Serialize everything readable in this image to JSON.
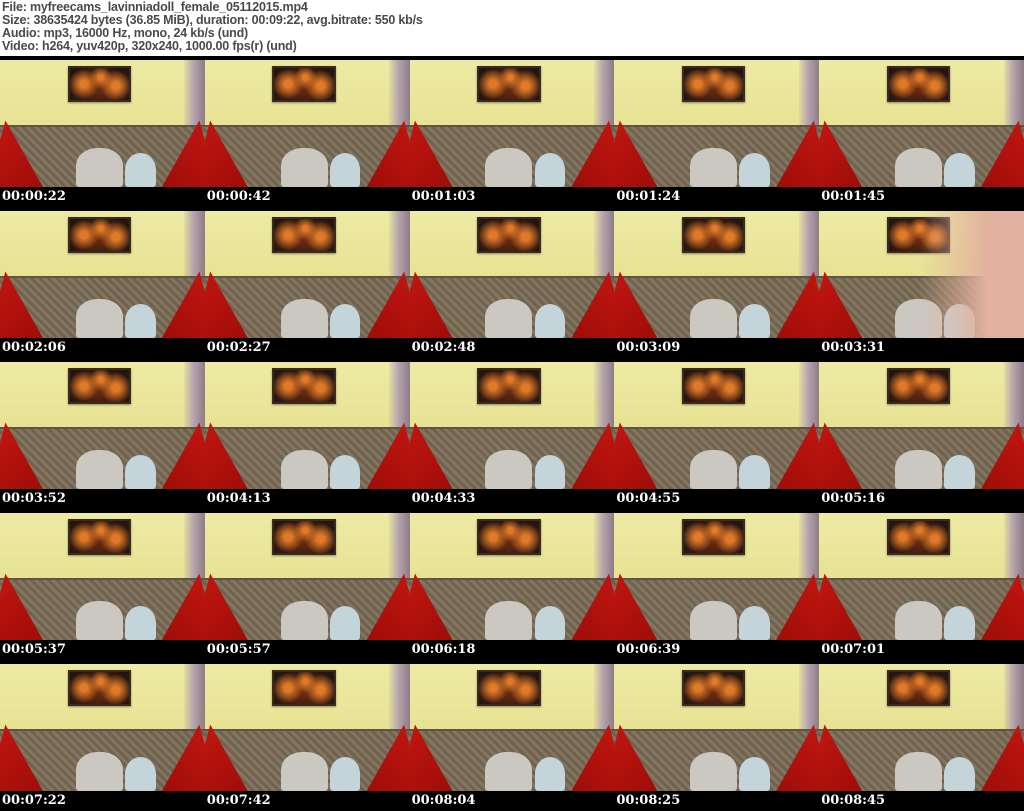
{
  "header": {
    "lines": [
      "File: myfreecams_lavinniadoll_female_05112015.mp4",
      "Size: 38635424 bytes (36.85 MiB), duration: 00:09:22, avg.bitrate: 550 kb/s",
      "Audio: mp3, 16000 Hz, mono, 24 kb/s (und)",
      "Video: h264, yuv420p, 320x240, 1000.00 fps(r) (und)"
    ]
  },
  "grid": {
    "columns": 5,
    "rows": 5,
    "thumbnails": [
      {
        "timestamp": "00:00:22",
        "variant": "room"
      },
      {
        "timestamp": "00:00:42",
        "variant": "room"
      },
      {
        "timestamp": "00:01:03",
        "variant": "room"
      },
      {
        "timestamp": "00:01:24",
        "variant": "room"
      },
      {
        "timestamp": "00:01:45",
        "variant": "room"
      },
      {
        "timestamp": "00:02:06",
        "variant": "room"
      },
      {
        "timestamp": "00:02:27",
        "variant": "room"
      },
      {
        "timestamp": "00:02:48",
        "variant": "room"
      },
      {
        "timestamp": "00:03:09",
        "variant": "room"
      },
      {
        "timestamp": "00:03:31",
        "variant": "closeup"
      },
      {
        "timestamp": "00:03:52",
        "variant": "room"
      },
      {
        "timestamp": "00:04:13",
        "variant": "room"
      },
      {
        "timestamp": "00:04:33",
        "variant": "room"
      },
      {
        "timestamp": "00:04:55",
        "variant": "room"
      },
      {
        "timestamp": "00:05:16",
        "variant": "room"
      },
      {
        "timestamp": "00:05:37",
        "variant": "room"
      },
      {
        "timestamp": "00:05:57",
        "variant": "room"
      },
      {
        "timestamp": "00:06:18",
        "variant": "room"
      },
      {
        "timestamp": "00:06:39",
        "variant": "room"
      },
      {
        "timestamp": "00:07:01",
        "variant": "room"
      },
      {
        "timestamp": "00:07:22",
        "variant": "room"
      },
      {
        "timestamp": "00:07:42",
        "variant": "room"
      },
      {
        "timestamp": "00:08:04",
        "variant": "room"
      },
      {
        "timestamp": "00:08:25",
        "variant": "room"
      },
      {
        "timestamp": "00:08:45",
        "variant": "room"
      }
    ]
  },
  "palette": {
    "header_bg": "#ffffff",
    "header_fg": "#4a4a4a",
    "timestamp_bg": "#000000",
    "timestamp_fg": "#ffffff",
    "letterbox": "#000000",
    "wall": "#e7e292",
    "wall_light": "#edeaa4",
    "couch": "#83755f",
    "couch_dark": "#6f6350",
    "couch_edge": "#5e5444",
    "pillow_red": "#c71712",
    "pillow_red_dark": "#9e0d08",
    "pillow_gray": "#cbc8c2",
    "pillow_blue": "#c3d4da",
    "painting_bg": "#241510",
    "flame": "#e07a28",
    "curtain": "#b5a4ad",
    "curtain_dark": "#8d7b85",
    "skin_blur": "#e2b29e"
  }
}
